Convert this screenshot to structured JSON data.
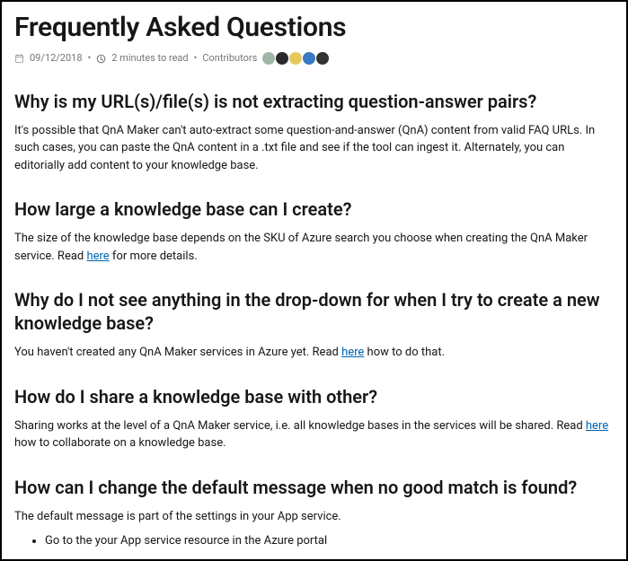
{
  "title": "Frequently Asked Questions",
  "meta": {
    "date": "09/12/2018",
    "readtime": "2 minutes to read",
    "contributors_label": "Contributors"
  },
  "avatars": [
    {
      "bg": "#9fb8a6"
    },
    {
      "bg": "#2a2a2a"
    },
    {
      "bg": "#e8c85c"
    },
    {
      "bg": "#3a78c4"
    },
    {
      "bg": "#333333"
    }
  ],
  "sections": [
    {
      "heading": "Why is my URL(s)/file(s) is not extracting question-answer pairs?",
      "p_pre": "It's possible that QnA Maker can't auto-extract some question-and-answer (QnA) content from valid FAQ URLs. In such cases, you can paste the QnA content in a .txt file and see if the tool can ingest it. Alternately, you can editorially add content to your knowledge base.",
      "link": "",
      "p_post": ""
    },
    {
      "heading": "How large a knowledge base can I create?",
      "p_pre": "The size of the knowledge base depends on the SKU of Azure search you choose when creating the QnA Maker service. Read ",
      "link": "here",
      "p_post": " for more details."
    },
    {
      "heading": "Why do I not see anything in the drop-down for when I try to create a new knowledge base?",
      "p_pre": "You haven't created any QnA Maker services in Azure yet. Read ",
      "link": "here",
      "p_post": " how to do that."
    },
    {
      "heading": "How do I share a knowledge base with other?",
      "p_pre": "Sharing works at the level of a QnA Maker service, i.e. all knowledge bases in the services will be shared. Read ",
      "link": "here",
      "p_post": " how to collaborate on a knowledge base."
    },
    {
      "heading": "How can I change the default message when no good match is found?",
      "p_pre": "The default message is part of the settings in your App service.",
      "link": "",
      "p_post": ""
    }
  ],
  "list": {
    "items": [
      "Go to the your App service resource in the Azure portal"
    ]
  }
}
